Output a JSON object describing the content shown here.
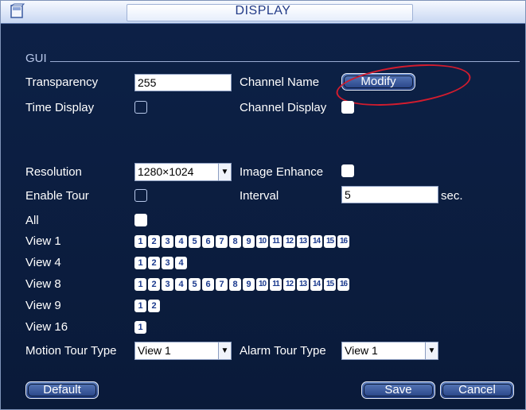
{
  "window": {
    "title": "DISPLAY"
  },
  "gui": {
    "section_label": "GUI"
  },
  "labels": {
    "transparency": "Transparency",
    "channel_name": "Channel Name",
    "time_display": "Time Display",
    "channel_display": "Channel Display",
    "resolution": "Resolution",
    "image_enhance": "Image Enhance",
    "enable_tour": "Enable Tour",
    "interval": "Interval",
    "interval_unit": "sec.",
    "all": "All",
    "motion_tour_type": "Motion Tour Type",
    "alarm_tour_type": "Alarm Tour Type"
  },
  "values": {
    "transparency": "255",
    "resolution": "1280×1024",
    "interval": "5",
    "motion_tour_type": "View 1",
    "alarm_tour_type": "View 1"
  },
  "checkboxes": {
    "time_display": false,
    "channel_display": true,
    "image_enhance": true,
    "enable_tour": false,
    "all": true
  },
  "buttons": {
    "modify": "Modify",
    "default": "Default",
    "save": "Save",
    "cancel": "Cancel"
  },
  "views": [
    {
      "label": "View 1",
      "channels": [
        "1",
        "2",
        "3",
        "4",
        "5",
        "6",
        "7",
        "8",
        "9",
        "10",
        "11",
        "12",
        "13",
        "14",
        "15",
        "16"
      ]
    },
    {
      "label": "View 4",
      "channels": [
        "1",
        "2",
        "3",
        "4"
      ]
    },
    {
      "label": "View 8",
      "channels": [
        "1",
        "2",
        "3",
        "4",
        "5",
        "6",
        "7",
        "8",
        "9",
        "10",
        "11",
        "12",
        "13",
        "14",
        "15",
        "16"
      ]
    },
    {
      "label": "View 9",
      "channels": [
        "1",
        "2"
      ]
    },
    {
      "label": "View 16",
      "channels": [
        "1"
      ]
    }
  ],
  "colors": {
    "background": "#0b1d3c",
    "title_text": "#213a87",
    "annotation": "#d21c2e"
  },
  "icons": {
    "window_icon": "window-icon",
    "dropdown_arrow": "dropdown-arrow-icon"
  }
}
